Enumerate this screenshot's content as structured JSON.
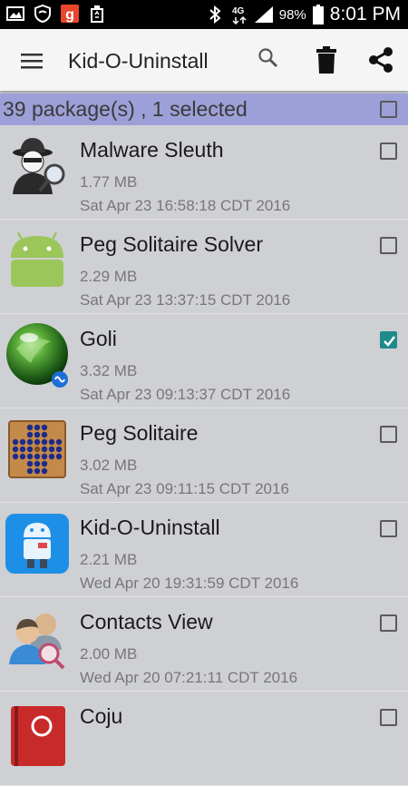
{
  "status_bar": {
    "time": "8:01 PM",
    "battery": "98%",
    "network": "4G",
    "icons": [
      "image-icon",
      "shield-icon",
      "g-app-icon",
      "recycle-icon",
      "bluetooth-icon",
      "4g-icon",
      "signal-icon",
      "battery-icon"
    ]
  },
  "app_bar": {
    "title": "Kid-O-Uninstall",
    "icons": [
      "menu-icon",
      "search-icon",
      "trash-icon",
      "share-icon"
    ]
  },
  "selection": {
    "summary": "39 package(s) , 1 selected",
    "all_checked": false
  },
  "packages": [
    {
      "name": "Malware Sleuth",
      "size": "1.77 MB",
      "date": "Sat Apr 23 16:58:18 CDT 2016",
      "icon": "detective-icon",
      "checked": false
    },
    {
      "name": "Peg Solitaire Solver",
      "size": "2.29 MB",
      "date": "Sat Apr 23 13:37:15 CDT 2016",
      "icon": "android-icon",
      "checked": false
    },
    {
      "name": "Goli",
      "size": "3.32 MB",
      "date": "Sat Apr 23 09:13:37 CDT 2016",
      "icon": "marble-icon",
      "checked": true
    },
    {
      "name": "Peg Solitaire",
      "size": "3.02 MB",
      "date": "Sat Apr 23 09:11:15 CDT 2016",
      "icon": "peg-board-icon",
      "checked": false
    },
    {
      "name": "Kid-O-Uninstall",
      "size": "2.21 MB",
      "date": "Wed Apr 20 19:31:59 CDT 2016",
      "icon": "kid-android-icon",
      "checked": false
    },
    {
      "name": "Contacts View",
      "size": "2.00 MB",
      "date": "Wed Apr 20 07:21:11 CDT 2016",
      "icon": "contacts-icon",
      "checked": false
    },
    {
      "name": "Coju",
      "size": "",
      "date": "",
      "icon": "book-icon",
      "checked": false
    }
  ],
  "colors": {
    "selection_bar": "#9d9fd8",
    "list_background": "#cfd0d4",
    "checked": "#1e8a8a"
  }
}
